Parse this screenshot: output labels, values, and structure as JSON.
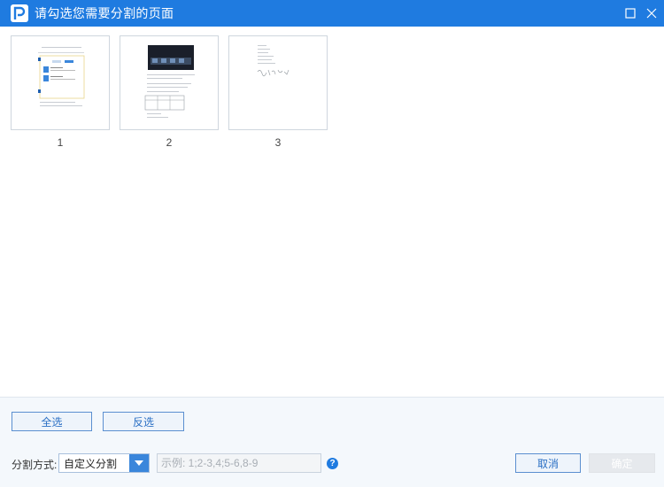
{
  "window": {
    "title": "请勾选您需要分割的页面",
    "accent": "#1f7be0"
  },
  "pages": [
    {
      "number": "1"
    },
    {
      "number": "2"
    },
    {
      "number": "3"
    }
  ],
  "actions": {
    "select_all": "全选",
    "invert": "反选"
  },
  "split": {
    "mode_label": "分割方式:",
    "mode_value": "自定义分割",
    "range_placeholder": "示例: 1;2-3,4;5-6,8-9",
    "help": "?"
  },
  "footer": {
    "cancel": "取消",
    "ok": "确定"
  }
}
